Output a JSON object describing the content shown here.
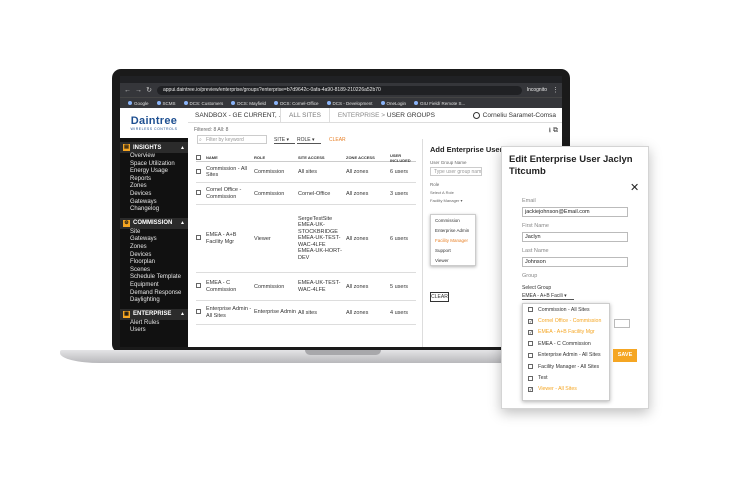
{
  "browser": {
    "url": "appui.daintree.io/preview/enterprise/groups?enterprise=b7d9642c-0afa-4a90-8189-210226a52b70",
    "incognito_label": "Incognito",
    "bookmarks": [
      "Google",
      "SCMS",
      "DCS: Customers",
      "DCS: Mayfield",
      "DCS: Cornel-Office",
      "DCS - Development",
      "OneLogin",
      "GIU Field/ Remote S..."
    ]
  },
  "sidebar": {
    "logo_name": "Daintree",
    "logo_sub": "WIRELESS CONTROLS",
    "sections": [
      {
        "title": "INSIGHTS",
        "items": [
          "Overview",
          "Space Utilization",
          "Energy Usage",
          "Reports",
          "Zones",
          "Devices",
          "Gateways",
          "Changelog"
        ]
      },
      {
        "title": "COMMISSION",
        "items": [
          "Site",
          "Gateways",
          "Zones",
          "Devices",
          "Floorplan",
          "Scenes",
          "Schedule Template",
          "Equipment",
          "Demand Response",
          "Daylighting"
        ]
      },
      {
        "title": "ENTERPRISE",
        "items": [
          "Alert Rules",
          "Users"
        ]
      }
    ]
  },
  "topbar": {
    "sandbox": "SANDBOX - GE CURRENT, ...",
    "all_sites": "ALL SITES",
    "crumb_parent": "ENTERPRISE",
    "crumb_sep": ">",
    "crumb_current": "USER GROUPS",
    "user_name": "Corneliu Saramet-Comsa"
  },
  "filters": {
    "counts": "Filtered: 8   All: 8",
    "search_placeholder": "Filter by keyword",
    "site_label": "SITE",
    "role_label": "ROLE",
    "clear_label": "CLEAR"
  },
  "table": {
    "headers": [
      "NAME",
      "ROLE",
      "SITE ACCESS",
      "ZONE ACCESS",
      "USER INCLUDED"
    ],
    "rows": [
      {
        "name": "Commission - All Sites",
        "role": "Commission",
        "site": "All sites",
        "zone": "All zones",
        "users": "6 users"
      },
      {
        "name": "Cornel Office - Commission",
        "role": "Commission",
        "site": "Cornel-Office",
        "zone": "All zones",
        "users": "3 users"
      },
      {
        "name": "EMEA - A+B Facility Mgr",
        "role": "Viewer",
        "site": "SergeTestSite\nEMEA-UK-STOCKBRIDGE\nEMEA-UK-TEST-WAC-4LFE\nEMEA-UK-HORT-DEV",
        "zone": "All zones",
        "users": "6 users"
      },
      {
        "name": "EMEA - C Commission",
        "role": "Commission",
        "site": "EMEA-UK-TEST-WAC-4LFE",
        "zone": "All zones",
        "users": "5 users"
      },
      {
        "name": "Enterprise Admin - All Sites",
        "role": "Enterprise Admin",
        "site": "All sites",
        "zone": "All zones",
        "users": "4 users"
      }
    ]
  },
  "add_panel": {
    "title": "Add Enterprise User Group",
    "name_label": "User Group Name",
    "name_placeholder": "Type user group name",
    "role_label": "Role",
    "select_role": "Select A Role",
    "role_value": "Facility Manager",
    "role_options": [
      "Commission",
      "Enterprise Admin",
      "Facility Manager",
      "Support",
      "Viewer"
    ],
    "role_selected": "Facility Manager",
    "clear_button": "CLEAR"
  },
  "edit_dialog": {
    "title": "Edit Enterprise User Jaclyn Titcumb",
    "close": "✕",
    "email_label": "Email",
    "email_value": "jackiejohnson@Email.com",
    "first_label": "First Name",
    "first_value": "Jaclyn",
    "last_label": "Last Name",
    "last_value": "Johnson",
    "group_label": "Group",
    "select_group": "Select Group",
    "group_value": "EMEA - A+B Facili",
    "groups": [
      {
        "label": "Commission - All Sites",
        "checked": false
      },
      {
        "label": "Cornel Office - Commission",
        "checked": true
      },
      {
        "label": "EMEA - A+B Facility Mgr",
        "checked": true
      },
      {
        "label": "EMEA - C Commission",
        "checked": false
      },
      {
        "label": "Enterprise Admin - All Sites",
        "checked": false
      },
      {
        "label": "Facility Manager - All Sites",
        "checked": false
      },
      {
        "label": "Test",
        "checked": false
      },
      {
        "label": "Viewer - All Sites",
        "checked": true
      }
    ],
    "save_button": "SAVE"
  },
  "colors": {
    "accent": "#f5a623",
    "brand": "#1d4f91",
    "sidebar": "#111111"
  }
}
